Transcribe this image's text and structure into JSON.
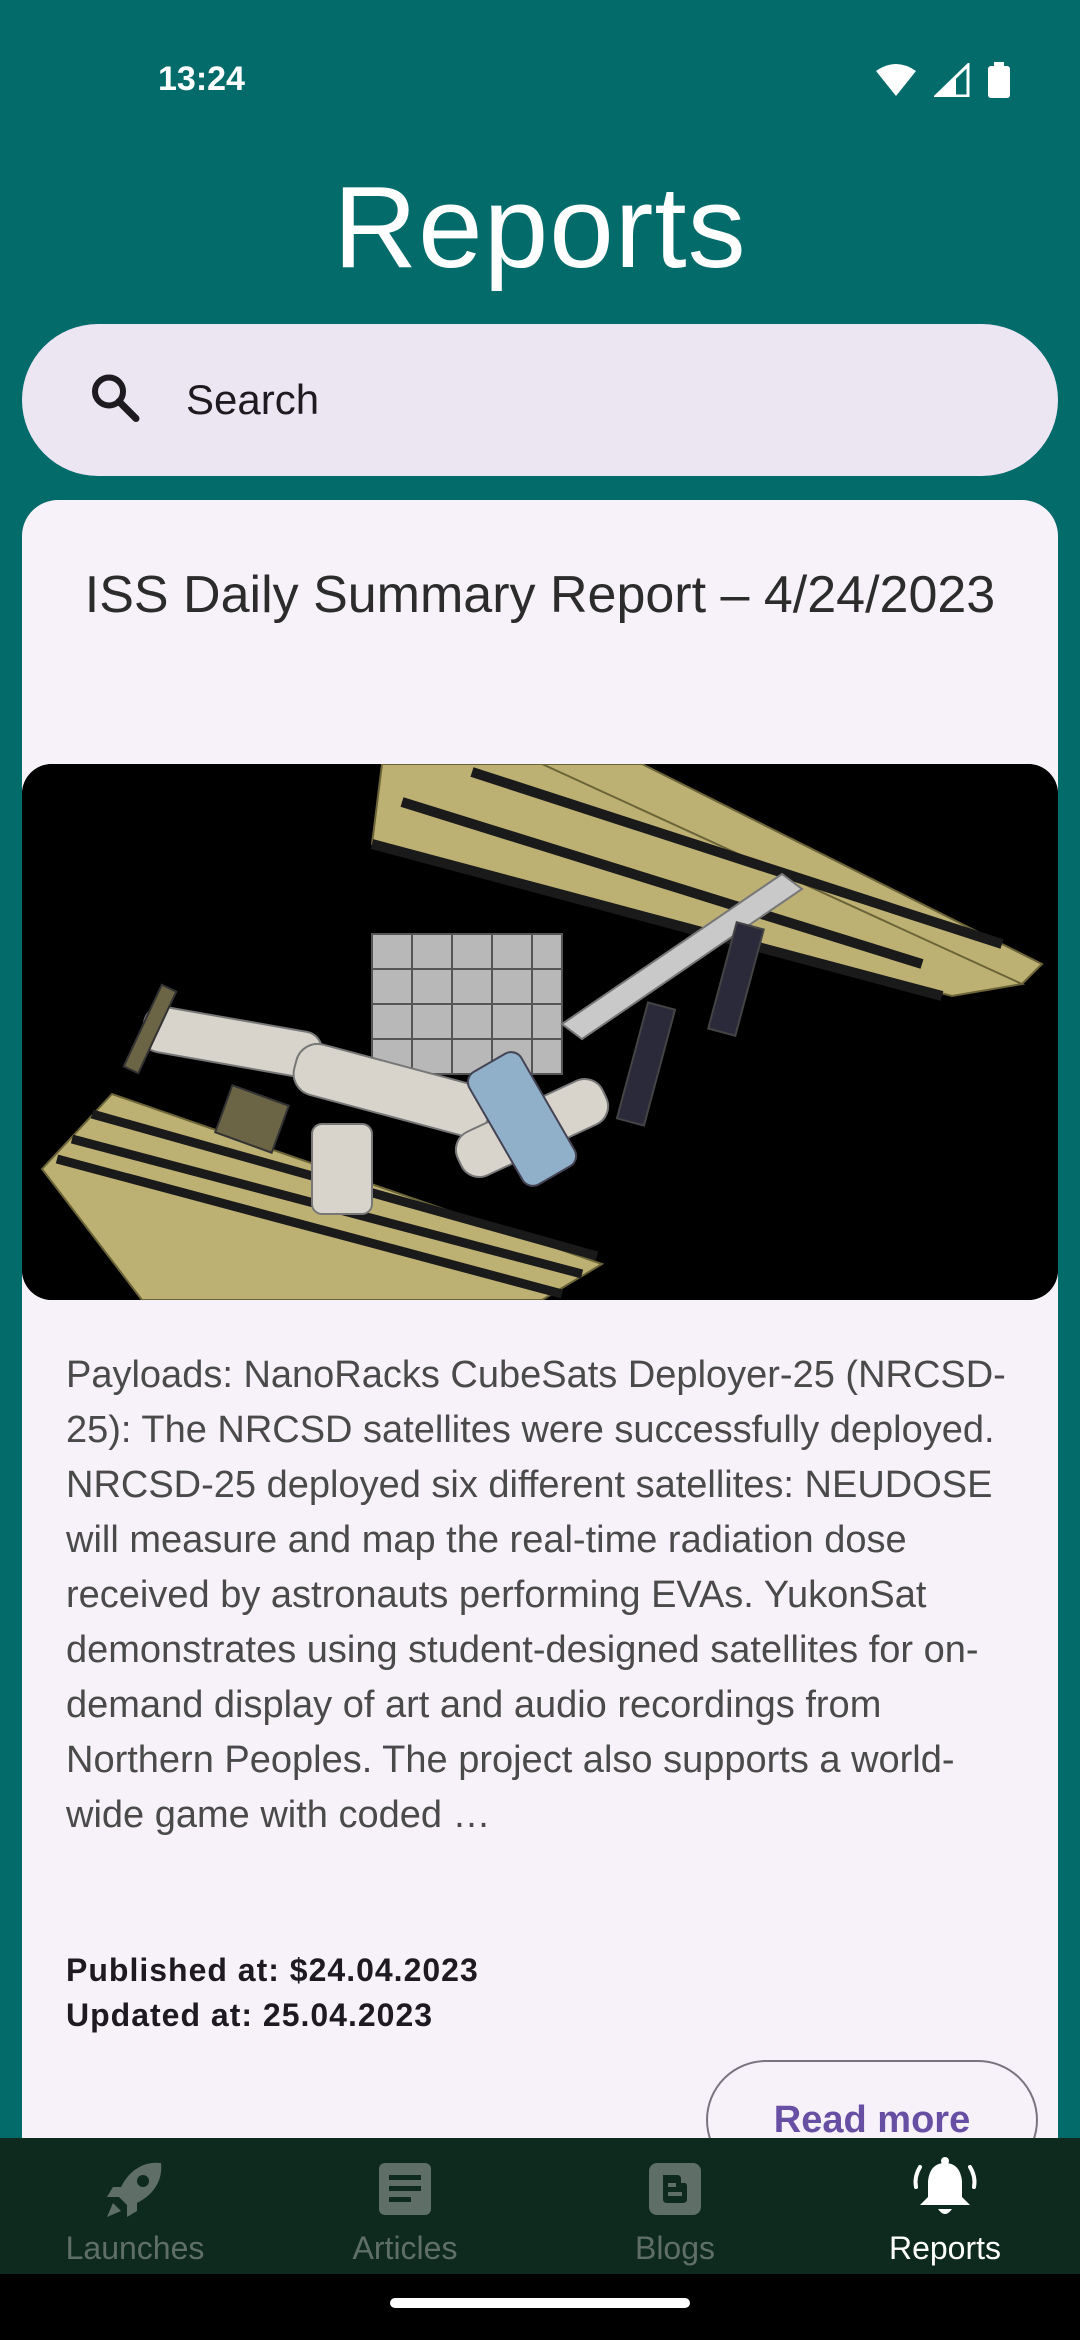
{
  "status_bar": {
    "time": "13:24"
  },
  "header": {
    "title": "Reports"
  },
  "search": {
    "placeholder": "Search"
  },
  "report": {
    "title": "ISS Daily Summary Report – 4/24/2023",
    "summary": "Payloads: NanoRacks CubeSats Deployer-25 (NRCSD-25): The NRCSD satellites were successfully deployed.  NRCSD-25 deployed six different satellites: NEUDOSE will measure and map the real-time radiation dose received by astronauts performing EVAs. YukonSat demonstrates using student-designed satellites for on-demand display of art and audio recordings from Northern Peoples. The project also supports a world-wide game with coded …",
    "published": "Published at: $24.04.2023",
    "updated": "Updated at: 25.04.2023",
    "read_more_label": "Read more"
  },
  "nav": {
    "items": [
      {
        "label": "Launches",
        "icon": "rocket-icon",
        "active": false
      },
      {
        "label": "Articles",
        "icon": "article-icon",
        "active": false
      },
      {
        "label": "Blogs",
        "icon": "blogger-icon",
        "active": false
      },
      {
        "label": "Reports",
        "icon": "bell-icon",
        "active": true
      }
    ]
  },
  "colors": {
    "header_bg": "#046b6b",
    "card_bg": "#f7f2fa",
    "search_bg": "#ece6f3",
    "accent": "#6750a4",
    "nav_bg": "#0e2a1e"
  }
}
